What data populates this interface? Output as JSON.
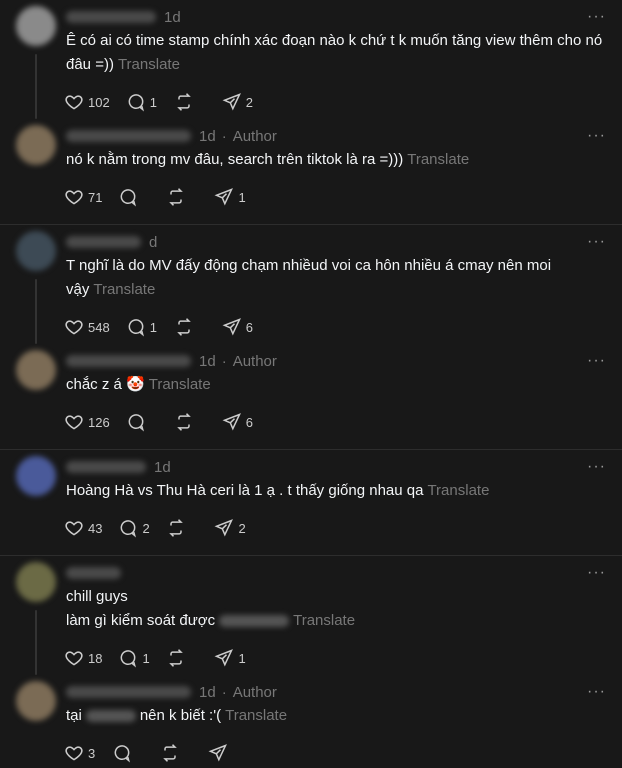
{
  "translate_label": "Translate",
  "more_label": "···",
  "threads": [
    {
      "posts": [
        {
          "time": "1d",
          "author": "",
          "text": "Ê có ai có time stamp chính xác đoạn nào k chứ t k muốn tăng view thêm cho nó đâu =))",
          "likes": "102",
          "replies": "1",
          "reposts": "",
          "shares": "2",
          "avatar_color": "#8a8a8a",
          "uname_w": 90
        },
        {
          "time": "1d",
          "author": "Author",
          "text": "nó k nằm trong mv đâu, search trên tiktok là ra =)))",
          "likes": "71",
          "replies": "",
          "reposts": "",
          "shares": "1",
          "avatar_color": "#7b6b55",
          "uname_w": 125
        }
      ]
    },
    {
      "posts": [
        {
          "time": "d",
          "author": "",
          "text": "T nghĩ là do MV đấy động chạm nhiềud voi ca hôn nhiều á cmay nên moi vậy",
          "likes": "548",
          "replies": "1",
          "reposts": "",
          "shares": "6",
          "avatar_color": "#3d4a55",
          "uname_w": 75
        },
        {
          "time": "1d",
          "author": "Author",
          "text": "chắc z á 🤡",
          "likes": "126",
          "replies": "",
          "reposts": "",
          "shares": "6",
          "avatar_color": "#7b6b55",
          "uname_w": 125
        }
      ]
    },
    {
      "posts": [
        {
          "time": "1d",
          "author": "",
          "text": "Hoàng Hà vs Thu Hà ceri là 1 ạ . t thấy giống nhau qa",
          "likes": "43",
          "replies": "2",
          "reposts": "",
          "shares": "2",
          "avatar_color": "#4a5a9a",
          "uname_w": 80
        }
      ]
    },
    {
      "posts": [
        {
          "time": "",
          "author": "",
          "text": "chill guys",
          "text2": "làm gì kiểm soát được",
          "likes": "18",
          "replies": "1",
          "reposts": "",
          "shares": "1",
          "avatar_color": "#6b6a45",
          "uname_w": 55
        },
        {
          "time": "1d",
          "author": "Author",
          "text": "tại",
          "text_after": "nên k biết :'(",
          "likes": "3",
          "replies": "",
          "reposts": "",
          "shares": "",
          "avatar_color": "#7b6b55",
          "uname_w": 125
        }
      ]
    }
  ]
}
